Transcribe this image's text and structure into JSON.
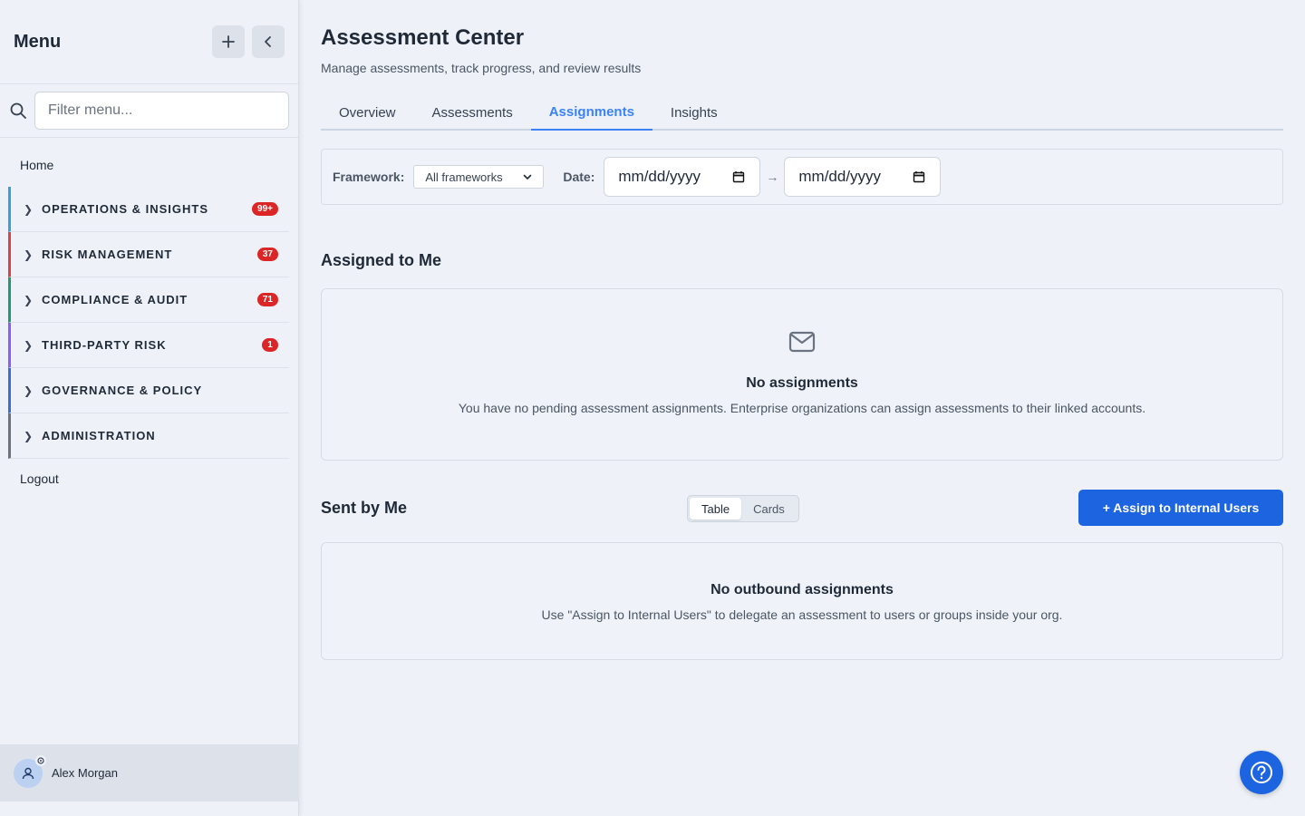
{
  "sidebar": {
    "title": "Menu",
    "filter_placeholder": "Filter menu...",
    "home_label": "Home",
    "logout_label": "Logout",
    "groups": [
      {
        "label": "OPERATIONS & INSIGHTS",
        "badge": "99+",
        "color": "#38a0d8"
      },
      {
        "label": "RISK MANAGEMENT",
        "badge": "37",
        "color": "#d64545"
      },
      {
        "label": "COMPLIANCE & AUDIT",
        "badge": "71",
        "color": "#1f9a72"
      },
      {
        "label": "THIRD-PARTY RISK",
        "badge": "1",
        "color": "#8b5cf6"
      },
      {
        "label": "GOVERNANCE & POLICY",
        "badge": "",
        "color": "#3b6fd1"
      },
      {
        "label": "ADMINISTRATION",
        "badge": "",
        "color": "#6b7280"
      }
    ],
    "user_name": "Alex Morgan"
  },
  "page": {
    "title": "Assessment Center",
    "subtitle": "Manage assessments, track progress, and review results"
  },
  "tabs": [
    {
      "label": "Overview",
      "active": false
    },
    {
      "label": "Assessments",
      "active": false
    },
    {
      "label": "Assignments",
      "active": true
    },
    {
      "label": "Insights",
      "active": false
    }
  ],
  "filters": {
    "framework_label": "Framework:",
    "framework_value": "All frameworks",
    "date_label": "Date:",
    "date_from": "mm/dd/yyyy",
    "date_to": "mm/dd/yyyy",
    "arrow": "→"
  },
  "assigned": {
    "title": "Assigned to Me",
    "empty_title": "No assignments",
    "empty_text": "You have no pending assessment assignments. Enterprise organizations can assign assessments to their linked accounts."
  },
  "sent": {
    "title": "Sent by Me",
    "view_table": "Table",
    "view_cards": "Cards",
    "assign_button": "+ Assign to Internal Users",
    "empty_title": "No outbound assignments",
    "empty_text": "Use \"Assign to Internal Users\" to delegate an assessment to users or groups inside your org."
  },
  "colors": {
    "accent": "#1d64e0",
    "tab_active": "#3b82f6",
    "badge": "#dc2626"
  }
}
